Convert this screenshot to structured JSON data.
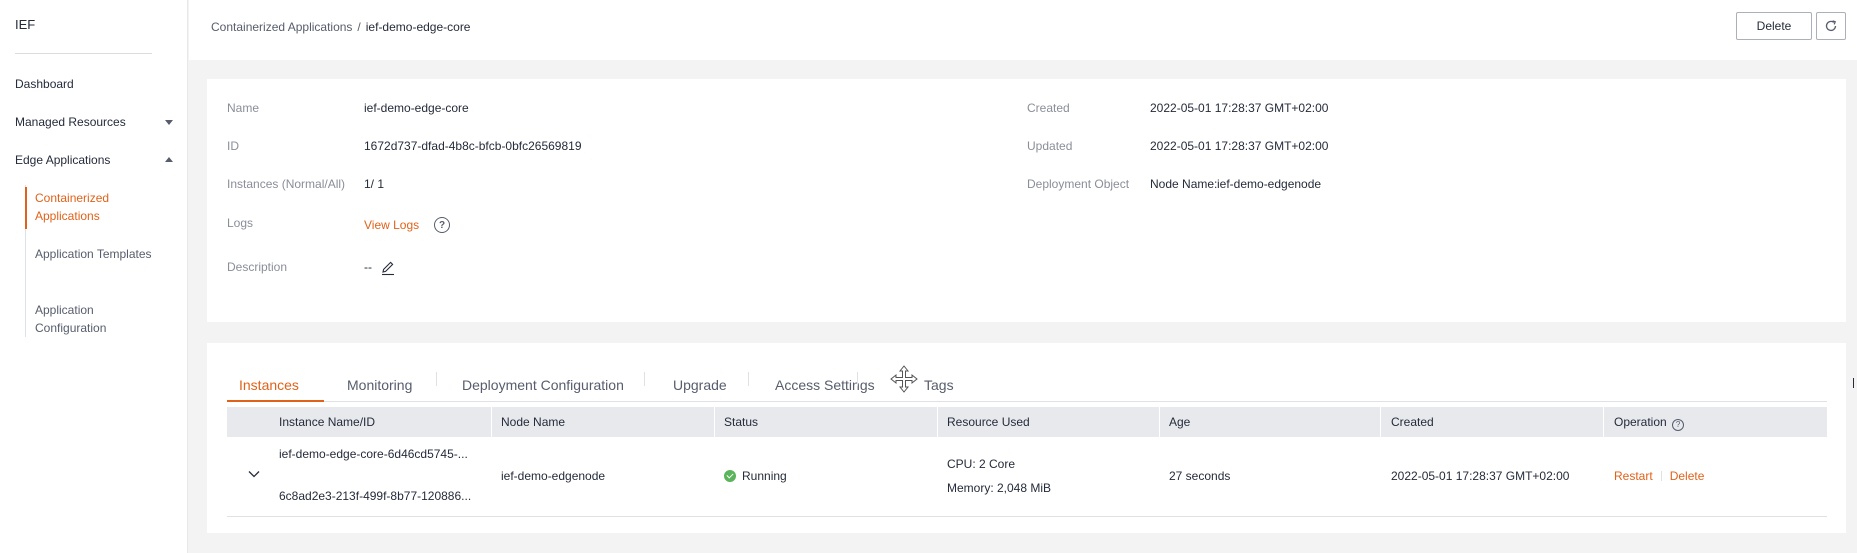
{
  "sidebar": {
    "logo": "IEF",
    "items": [
      {
        "label": "Dashboard"
      },
      {
        "label": "Managed Resources"
      },
      {
        "label": "Edge Applications"
      }
    ],
    "subitems": [
      {
        "label": "Containerized Applications",
        "active": true
      },
      {
        "label": "Application Templates"
      },
      {
        "label": "Application Configuration"
      }
    ]
  },
  "header": {
    "breadcrumb_parent": "Containerized Applications",
    "breadcrumb_separator": "/",
    "breadcrumb_current": "ief-demo-edge-core",
    "delete_label": "Delete"
  },
  "details": {
    "name_label": "Name",
    "name_value": "ief-demo-edge-core",
    "id_label": "ID",
    "id_value": "1672d737-dfad-4b8c-bfcb-0bfc26569819",
    "instances_label": "Instances (Normal/All)",
    "instances_value": "1/ 1",
    "logs_label": "Logs",
    "logs_link": "View Logs",
    "description_label": "Description",
    "description_value": "--",
    "created_label": "Created",
    "created_value": "2022-05-01 17:28:37 GMT+02:00",
    "updated_label": "Updated",
    "updated_value": "2022-05-01 17:28:37 GMT+02:00",
    "deployment_label": "Deployment Object",
    "deployment_key": "Node Name:",
    "deployment_value": "ief-demo-edgenode"
  },
  "tabs": [
    {
      "label": "Instances",
      "active": true
    },
    {
      "label": "Monitoring"
    },
    {
      "label": "Deployment Configuration"
    },
    {
      "label": "Upgrade"
    },
    {
      "label": "Access Settings"
    },
    {
      "label": "Tags"
    }
  ],
  "table": {
    "columns": [
      "Instance Name/ID",
      "Node Name",
      "Status",
      "Resource Used",
      "Age",
      "Created",
      "Operation"
    ],
    "rows": [
      {
        "instance_name": "ief-demo-edge-core-6d46cd5745-...",
        "instance_id": "6c8ad2e3-213f-499f-8b77-120886...",
        "node_name": "ief-demo-edgenode",
        "status": "Running",
        "cpu": "CPU: 2 Core",
        "memory": "Memory: 2,048 MiB",
        "age": "27 seconds",
        "created": "2022-05-01 17:28:37 GMT+02:00",
        "op_restart": "Restart",
        "op_delete": "Delete"
      }
    ]
  },
  "colors": {
    "accent": "#e0621a",
    "success": "#5bb35b",
    "text": "#252b3a",
    "muted": "#8a8e99"
  }
}
